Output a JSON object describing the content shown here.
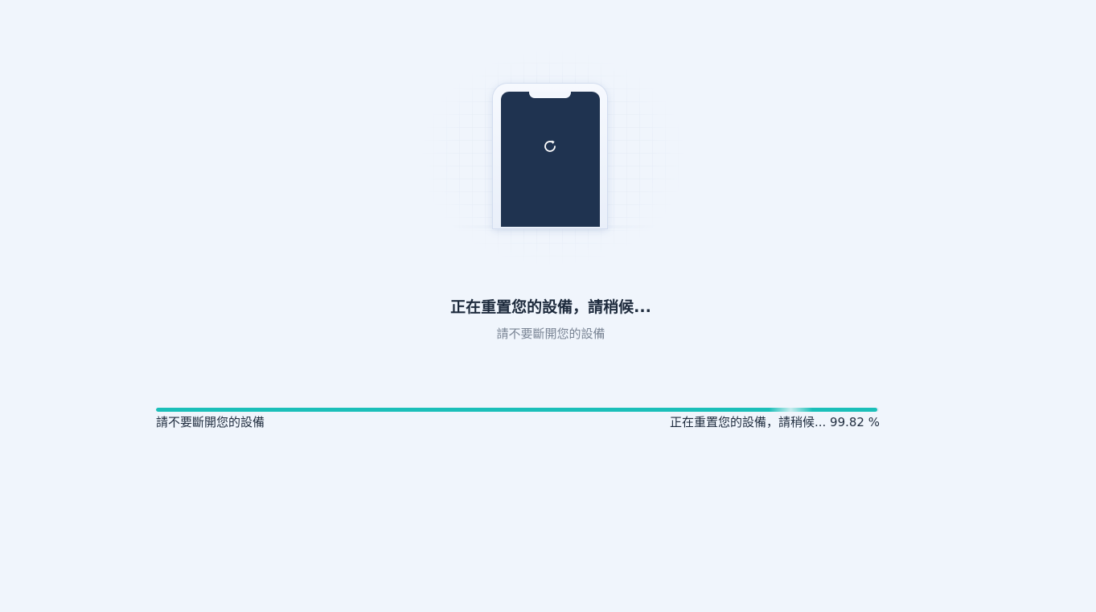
{
  "status": {
    "title": "正在重置您的設備，請稍候...",
    "subtitle": "請不要斷開您的設備"
  },
  "progress": {
    "left_label": "請不要斷開您的設備",
    "right_label": "正在重置您的設備，請稍候...",
    "percent_text": "99.82 %",
    "percent": 99.82
  },
  "icons": {
    "illustration": "phone-illustration",
    "refresh": "refresh-icon"
  },
  "colors": {
    "background": "#f0f5fc",
    "phone_screen": "#1f3350",
    "progress_fill": "#1bbfb9",
    "text_primary": "#1d2a3c",
    "text_secondary": "#7a8595"
  }
}
